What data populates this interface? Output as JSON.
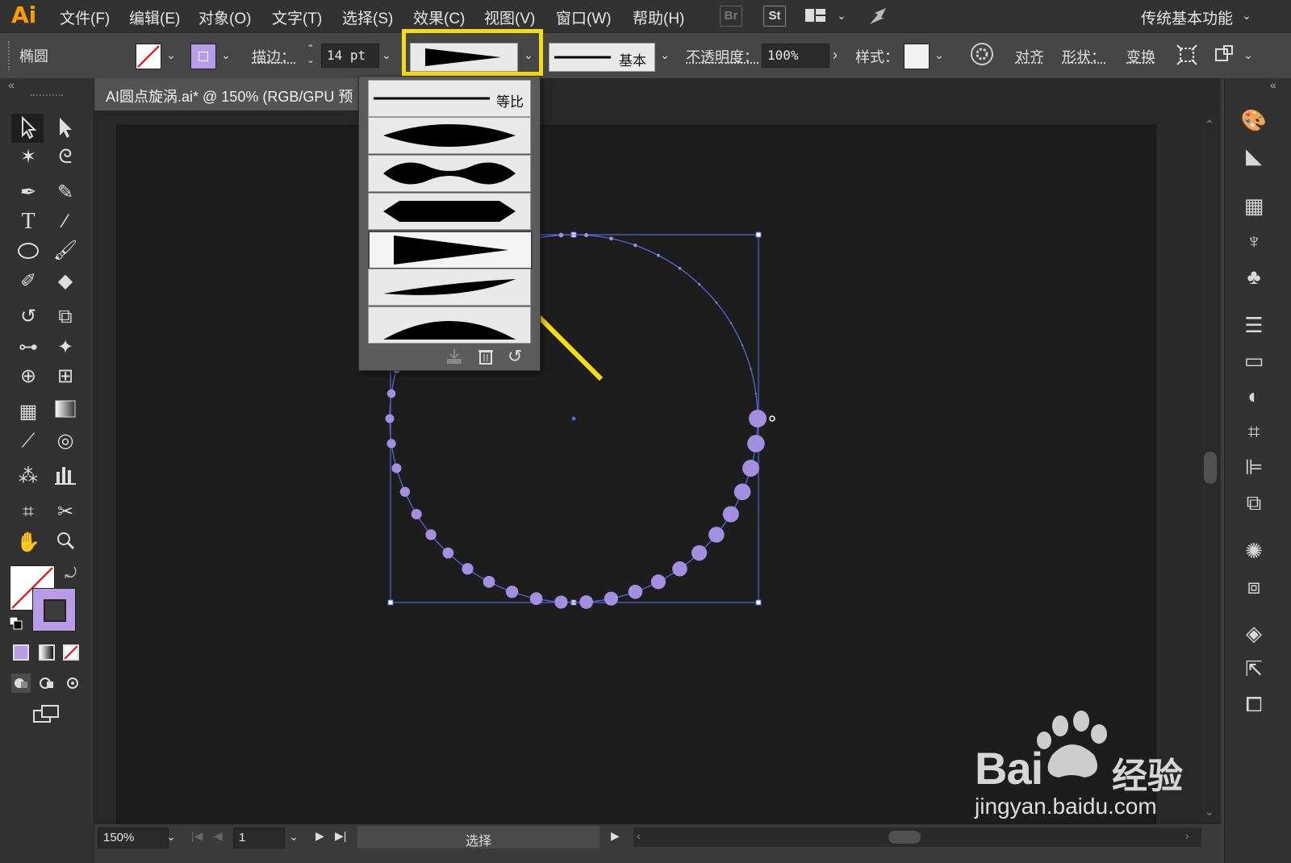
{
  "menubar": {
    "logo": "Ai",
    "items": [
      "文件(F)",
      "编辑(E)",
      "对象(O)",
      "文字(T)",
      "选择(S)",
      "效果(C)",
      "视图(V)",
      "窗口(W)",
      "帮助(H)"
    ],
    "bridge_label": "Br",
    "stock_label": "St",
    "workspace": "传统基本功能"
  },
  "control": {
    "object_name": "椭圆",
    "stroke_label": "描边：",
    "stroke_weight": "14 pt",
    "brush_label": "基本",
    "opacity_label": "不透明度：",
    "opacity_value": "100%",
    "style_label": "样式：",
    "align_label": "对齐",
    "shape_label": "形状：",
    "transform_label": "变换"
  },
  "document": {
    "tab_title": "AI圆点旋涡.ai* @ 150% (RGB/GPU 预"
  },
  "profile_popup": {
    "uniform_label": "等比",
    "selected_index": 4,
    "profiles": [
      "uniform",
      "width-profile-1",
      "width-profile-2",
      "width-profile-3",
      "width-profile-4",
      "width-profile-5",
      "width-profile-6"
    ]
  },
  "status": {
    "zoom": "150%",
    "page": "1",
    "tool_label": "选择"
  },
  "watermark": {
    "brand": "Bai",
    "brand2": "经验",
    "url": "jingyan.baidu.com"
  },
  "colors": {
    "accent_highlight": "#f6dc15",
    "dot_fill": "#a28fe0",
    "selection_blue": "#4f6bd8",
    "fill_swatch": "#b79ce8"
  }
}
